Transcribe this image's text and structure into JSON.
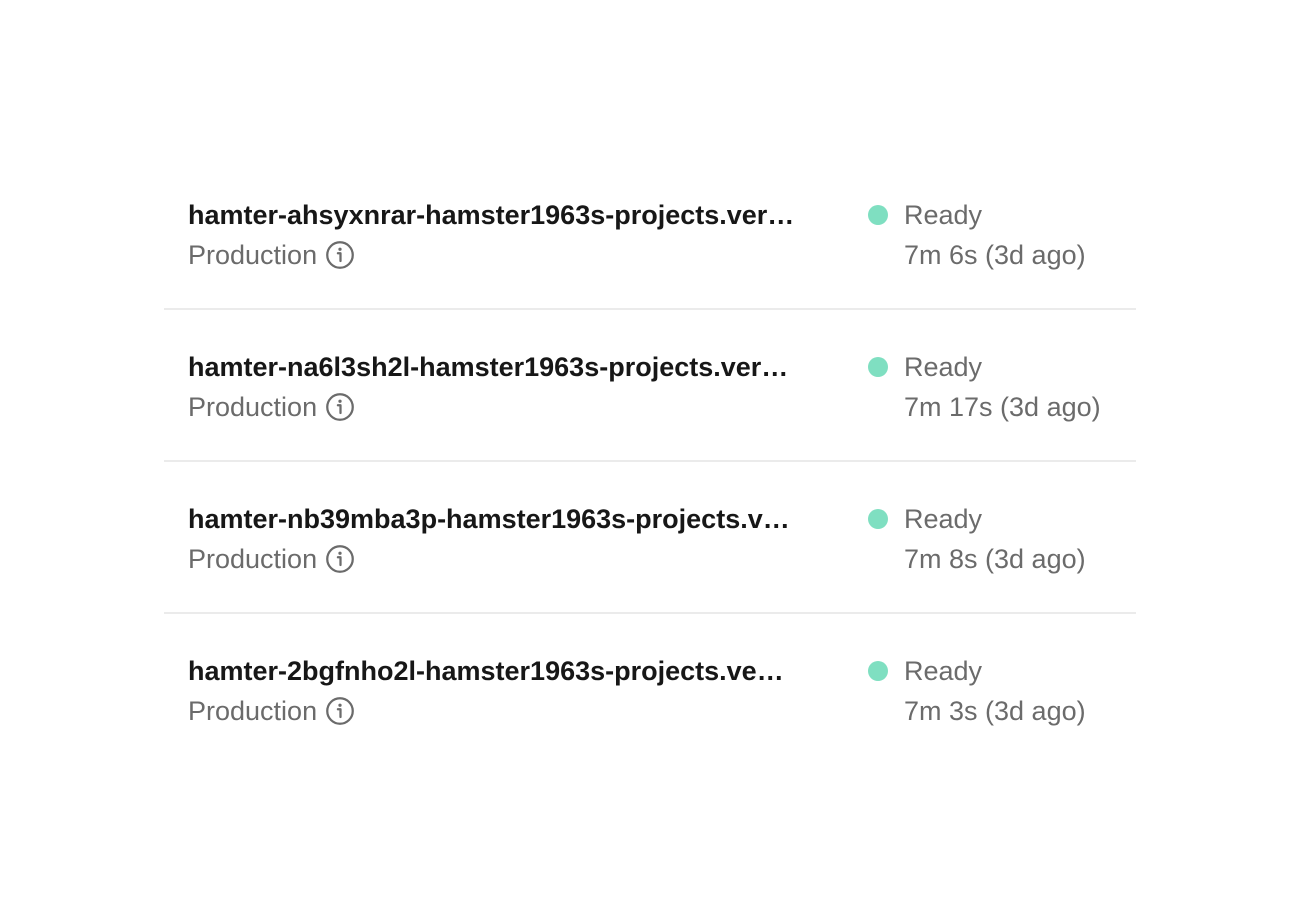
{
  "colors": {
    "ready": "#7fdfc1",
    "primary_text": "#171717",
    "secondary_text": "#6b6b6b",
    "divider": "#ebebeb"
  },
  "deployments": [
    {
      "url": "hamter-ahsyxnrar-hamster1963s-projects.ver…",
      "environment": "Production",
      "info_icon": "info-circle-icon",
      "status": "Ready",
      "duration": "7m 6s (3d ago)"
    },
    {
      "url": "hamter-na6l3sh2l-hamster1963s-projects.ver…",
      "environment": "Production",
      "info_icon": "info-circle-icon",
      "status": "Ready",
      "duration": "7m 17s (3d ago)"
    },
    {
      "url": "hamter-nb39mba3p-hamster1963s-projects.v…",
      "environment": "Production",
      "info_icon": "info-circle-icon",
      "status": "Ready",
      "duration": "7m 8s (3d ago)"
    },
    {
      "url": "hamter-2bgfnho2l-hamster1963s-projects.ve…",
      "environment": "Production",
      "info_icon": "info-circle-icon",
      "status": "Ready",
      "duration": "7m 3s (3d ago)"
    }
  ]
}
